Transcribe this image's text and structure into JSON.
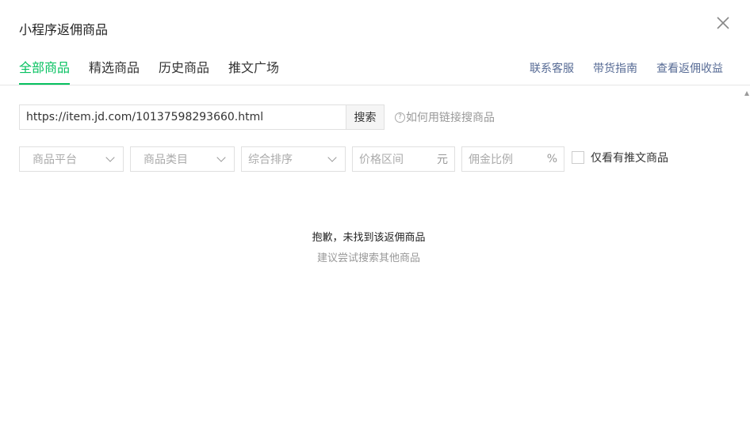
{
  "dialog": {
    "title": "小程序返佣商品"
  },
  "tabs": [
    {
      "label": "全部商品",
      "active": true
    },
    {
      "label": "精选商品",
      "active": false
    },
    {
      "label": "历史商品",
      "active": false
    },
    {
      "label": "推文广场",
      "active": false
    }
  ],
  "links": {
    "contact": "联系客服",
    "guide": "带货指南",
    "earnings": "查看返佣收益"
  },
  "search": {
    "value": "https://item.jd.com/10137598293660.html",
    "button": "搜索",
    "help": "如何用链接搜商品",
    "help_icon_glyph": "?"
  },
  "filters": {
    "platform": "商品平台",
    "category": "商品类目",
    "sort": "综合排序",
    "price_placeholder": "价格区间",
    "price_unit": "元",
    "commission_placeholder": "佣金比例",
    "commission_unit": "%",
    "only_articles": "仅看有推文商品",
    "only_articles_checked": false
  },
  "empty": {
    "title": "抱歉，未找到该返佣商品",
    "subtitle": "建议尝试搜索其他商品"
  },
  "colors": {
    "accent": "#07c160",
    "link": "#576b95"
  }
}
